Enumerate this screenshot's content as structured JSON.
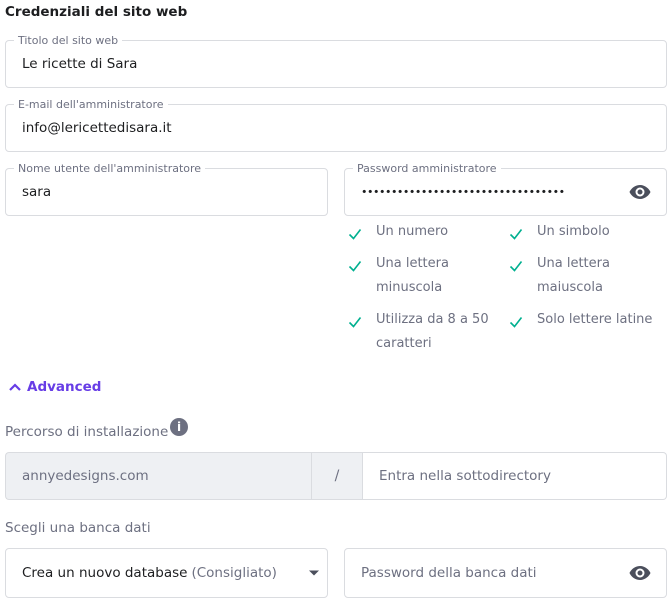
{
  "section": {
    "title": "Credenziali del sito web"
  },
  "site_title": {
    "legend": "Titolo del sito web",
    "value": "Le ricette di Sara"
  },
  "admin_email": {
    "legend": "E-mail dell'amministratore",
    "value": "info@lericettedisara.it"
  },
  "admin_username": {
    "legend": "Nome utente dell'amministratore",
    "value": "sara"
  },
  "admin_password": {
    "legend": "Password amministratore",
    "value": "••••••••••••••••••••••••••••••••••",
    "icon": "eye-icon"
  },
  "password_rules": [
    {
      "text": "Un numero",
      "met": true
    },
    {
      "text": "Un simbolo",
      "met": true
    },
    {
      "text": "Una lettera minuscola",
      "met": true
    },
    {
      "text": "Una lettera maiuscola",
      "met": true
    },
    {
      "text": "Utilizza da 8 a 50 caratteri",
      "met": true
    },
    {
      "text": "Solo lettere latine",
      "met": true
    }
  ],
  "advanced": {
    "label": "Advanced",
    "icon": "chevron-up-icon"
  },
  "install_path": {
    "label": "Percorso di installazione",
    "info_icon": "info-icon",
    "domain": "annyedesigns.com",
    "separator": "/",
    "subdir_placeholder": "Entra nella sottodirectory"
  },
  "database": {
    "label": "Scegli una banca dati",
    "selected": "Crea un nuovo database",
    "selected_hint": "(Consigliato)",
    "password_placeholder": "Password della banca dati"
  },
  "colors": {
    "accent": "#673de6",
    "check": "#00b090",
    "text": "#1d1e20",
    "muted": "#6d7081",
    "border": "#dadce0"
  }
}
